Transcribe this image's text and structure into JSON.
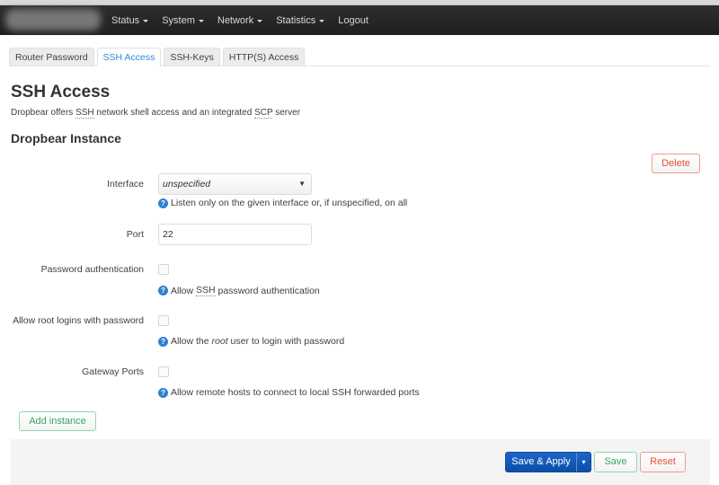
{
  "navbar": {
    "brand": "",
    "items": [
      {
        "label": "Status",
        "has_dropdown": true
      },
      {
        "label": "System",
        "has_dropdown": true
      },
      {
        "label": "Network",
        "has_dropdown": true
      },
      {
        "label": "Statistics",
        "has_dropdown": true
      },
      {
        "label": "Logout",
        "has_dropdown": false
      }
    ]
  },
  "tabs": [
    {
      "label": "Router Password",
      "active": false
    },
    {
      "label": "SSH Access",
      "active": true
    },
    {
      "label": "SSH-Keys",
      "active": false
    },
    {
      "label": "HTTP(S) Access",
      "active": false
    }
  ],
  "page": {
    "title": "SSH Access",
    "description_parts": [
      "Dropbear offers ",
      "SSH",
      " network shell access and an integrated ",
      "SCP",
      " server"
    ]
  },
  "section": {
    "title": "Dropbear Instance",
    "delete_label": "Delete"
  },
  "fields": {
    "interface": {
      "label": "Interface",
      "value": "unspecified",
      "help": "Listen only on the given interface or, if unspecified, on all"
    },
    "port": {
      "label": "Port",
      "value": "22"
    },
    "password_auth": {
      "label": "Password authentication",
      "checked": false,
      "help_parts": [
        "Allow ",
        "SSH",
        " password authentication"
      ]
    },
    "root_password": {
      "label": "Allow root logins with password",
      "checked": false,
      "help_parts": [
        "Allow the ",
        "root",
        " user to login with password"
      ]
    },
    "gateway_ports": {
      "label": "Gateway Ports",
      "checked": false,
      "help": "Allow remote hosts to connect to local SSH forwarded ports"
    }
  },
  "actions": {
    "add_instance": "Add instance",
    "save_apply": "Save & Apply",
    "dropdown_glyph": "▾",
    "save": "Save",
    "reset": "Reset"
  },
  "icons": {
    "help": "?",
    "select_arrow": "▼"
  },
  "colors": {
    "navbar_bg": "#262626",
    "accent_blue": "#2f88d8",
    "primary_button": "#1459b8",
    "positive_green": "#35a861",
    "negative_red": "#e4503c"
  }
}
